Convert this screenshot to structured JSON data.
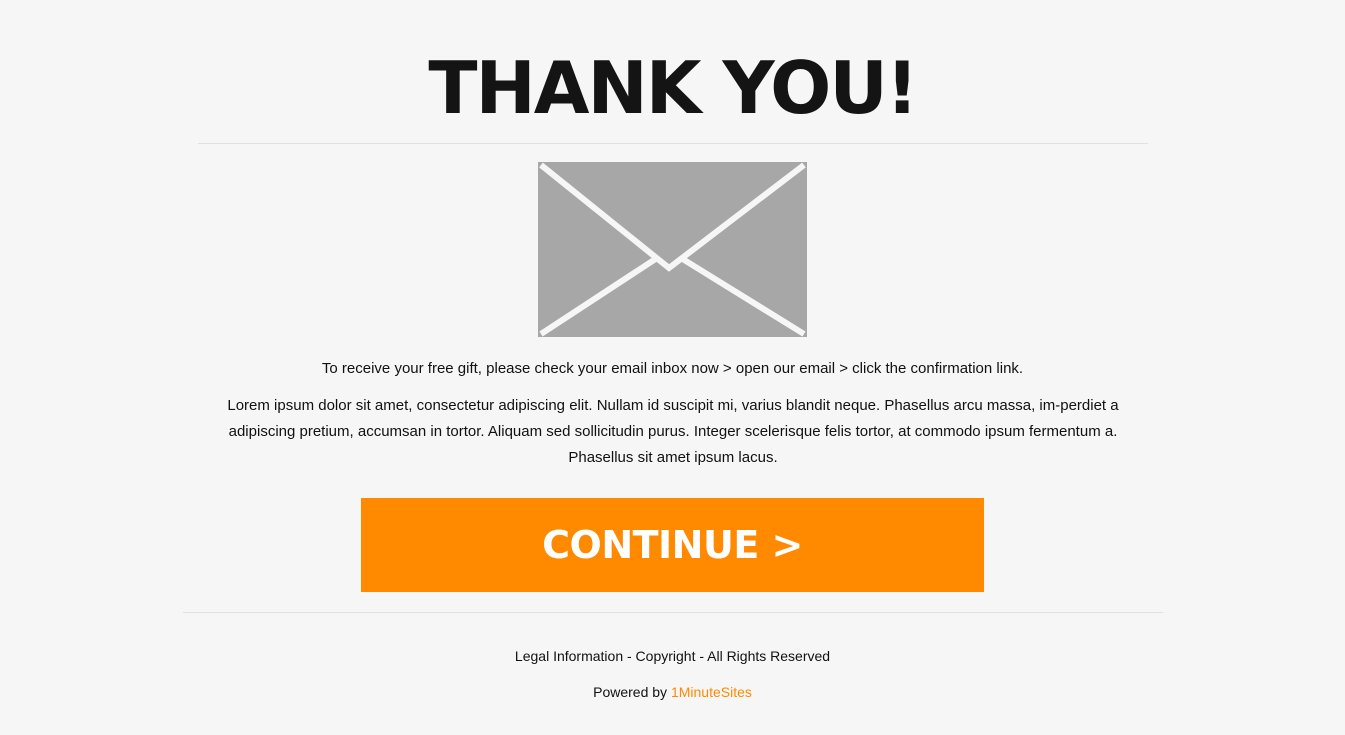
{
  "page": {
    "title": "THANK YOU!",
    "lead_text": "To receive your free gift, please check your email inbox now > open our email > click the confirmation link.",
    "body_text": "Lorem ipsum dolor sit amet, consectetur adipiscing elit. Nullam id suscipit mi, varius blandit neque. Phasellus arcu massa, im-perdiet a adipiscing pretium, accumsan in tortor. Aliquam sed sollicitudin purus. Integer scelerisque felis tortor, at commodo ipsum fermentum a. Phasellus sit amet ipsum lacus."
  },
  "icon": {
    "name": "envelope-icon",
    "color": "#a7a7a7"
  },
  "cta": {
    "label": "CONTINUE >",
    "color": "#ff8a00"
  },
  "footer": {
    "legal": "Legal Information - Copyright - All Rights Reserved",
    "powered_prefix": "Powered by",
    "powered_link": "1MinuteSites",
    "link_color": "#ff8a00"
  }
}
